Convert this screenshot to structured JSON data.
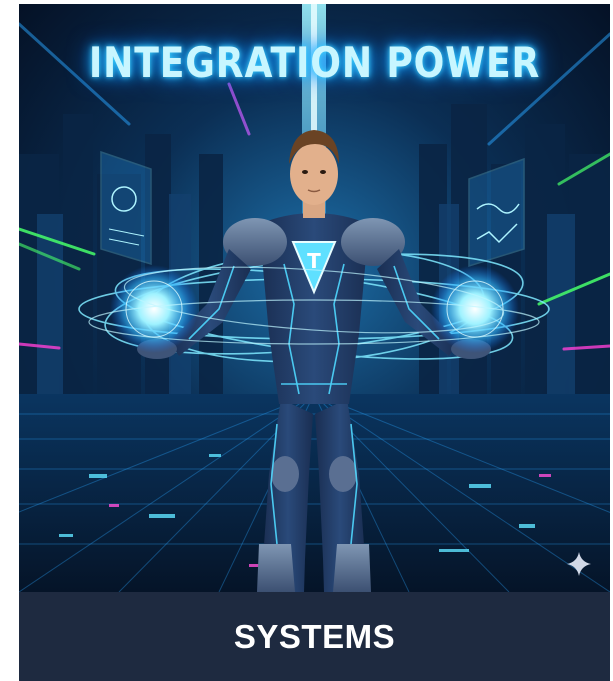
{
  "image": {
    "headline": "INTEGRATION POWER",
    "emblem_letter": "T",
    "subject": "hero",
    "accent_color": "#3fd6ff",
    "background_color": "#07182e"
  },
  "caption": {
    "label": "SYSTEMS",
    "bar_color": "#1e2a40"
  },
  "icons": {
    "watermark": "sparkle-icon"
  }
}
